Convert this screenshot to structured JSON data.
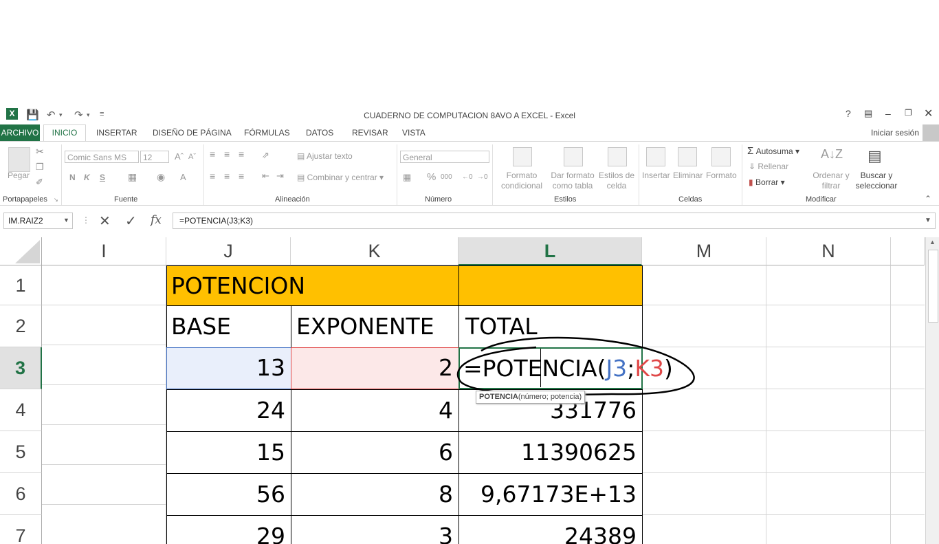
{
  "window": {
    "title": "CUADERNO DE COMPUTACION 8AVO A EXCEL - Excel",
    "help": "?",
    "signin": "Iniciar sesión"
  },
  "tabs": [
    "ARCHIVO",
    "INICIO",
    "INSERTAR",
    "DISEÑO DE PÁGINA",
    "FÓRMULAS",
    "DATOS",
    "REVISAR",
    "VISTA"
  ],
  "ribbon": {
    "clipboard": {
      "paste": "Pegar",
      "group": "Portapapeles"
    },
    "font": {
      "name": "Comic Sans MS",
      "size": "12",
      "bold": "N",
      "italic": "K",
      "underline": "S",
      "group": "Fuente"
    },
    "alignment": {
      "wrap": "Ajustar texto",
      "merge": "Combinar y centrar",
      "group": "Alineación"
    },
    "number": {
      "format": "General",
      "percent": "%",
      "thousands": "000",
      "group": "Número"
    },
    "styles": {
      "cond_l1": "Formato",
      "cond_l2": "condicional",
      "table_l1": "Dar formato",
      "table_l2": "como tabla",
      "cell_l1": "Estilos de",
      "cell_l2": "celda",
      "group": "Estilos"
    },
    "cells": {
      "insert": "Insertar",
      "delete": "Eliminar",
      "format": "Formato",
      "group": "Celdas"
    },
    "editing": {
      "autosum": "Autosuma",
      "fill": "Rellenar",
      "clear": "Borrar",
      "sort_l1": "Ordenar y",
      "sort_l2": "filtrar",
      "find_l1": "Buscar y",
      "find_l2": "seleccionar",
      "group": "Modificar"
    }
  },
  "formula_bar": {
    "name_box": "IM.RAIZ2",
    "fx": "fx",
    "formula": "=POTENCIA(J3;K3)"
  },
  "columns": [
    "I",
    "J",
    "K",
    "L",
    "M",
    "N"
  ],
  "rows": [
    "1",
    "2",
    "3",
    "4",
    "5",
    "6",
    "7"
  ],
  "sheet": {
    "title": "POTENCION",
    "headers": {
      "base": "BASE",
      "exponent": "EXPONENTE",
      "total": "TOTAL"
    },
    "r3": {
      "base": "13",
      "exp": "2"
    },
    "r4": {
      "base": "24",
      "exp": "4",
      "total": "331776"
    },
    "r5": {
      "base": "15",
      "exp": "6",
      "total": "11390625"
    },
    "r6": {
      "base": "56",
      "exp": "8",
      "total": "9,67173E+13"
    },
    "r7": {
      "base": "29",
      "exp": "3",
      "total": "24389"
    },
    "editing": {
      "eq": "=POTENCIA(",
      "ref1": "J3",
      "sep": ";",
      "ref2": "K3",
      "close": ")"
    },
    "tooltip": {
      "fn": "POTENCIA",
      "args": "(número; potencia)"
    }
  },
  "colors": {
    "accent": "#217346",
    "title_fill": "#ffc000",
    "ref1": "#4472c4",
    "ref2": "#e04848"
  }
}
